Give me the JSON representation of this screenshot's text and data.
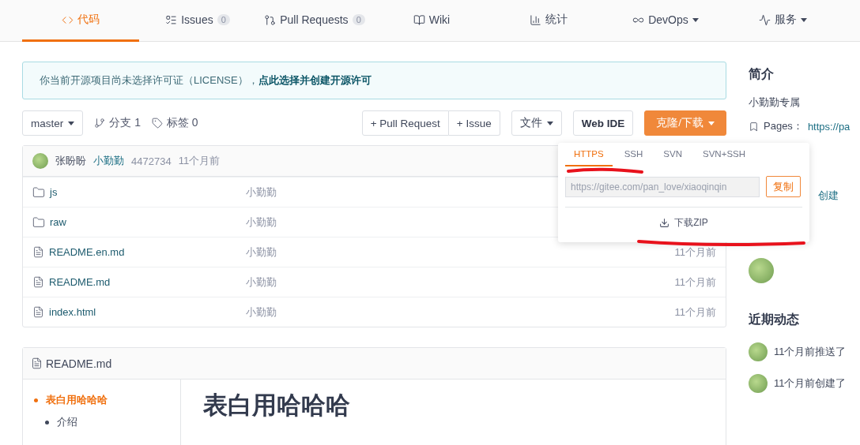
{
  "nav_tabs": [
    {
      "kind": "code",
      "label": "代码",
      "selected": true
    },
    {
      "kind": "issues",
      "label": "Issues",
      "count": "0",
      "selected": false
    },
    {
      "kind": "pr",
      "label": "Pull Requests",
      "count": "0",
      "selected": false
    },
    {
      "kind": "wiki",
      "label": "Wiki",
      "selected": false
    },
    {
      "kind": "stats",
      "label": "统计",
      "selected": false
    },
    {
      "kind": "devops",
      "label": "DevOps",
      "menu": true,
      "selected": false
    },
    {
      "kind": "service",
      "label": "服务",
      "menu": true,
      "selected": false
    }
  ],
  "license_notice": {
    "text": "你当前开源项目尚未选择许可证（LICENSE），",
    "link": "点此选择并创建开源许可"
  },
  "toolbar": {
    "branch": "master",
    "branches": "分支 1",
    "tags": "标签 0",
    "new_pr": "+ Pull Request",
    "new_issue": "+ Issue",
    "file_menu": "文件",
    "web_ide": "Web IDE",
    "clone": "克隆/下载"
  },
  "commit": {
    "author": "张盼盼",
    "message": "小勤勤",
    "hash": "4472734",
    "time": "11个月前"
  },
  "files": [
    {
      "kind": "folder",
      "name": "js",
      "commit": "小勤勤"
    },
    {
      "kind": "folder",
      "name": "raw",
      "commit": "小勤勤"
    },
    {
      "kind": "file",
      "name": "README.en.md",
      "commit": "小勤勤",
      "time": "11个月前"
    },
    {
      "kind": "file",
      "name": "README.md",
      "commit": "小勤勤",
      "time": "11个月前"
    },
    {
      "kind": "file",
      "name": "index.html",
      "commit": "小勤勤",
      "time": "11个月前"
    }
  ],
  "clone_popup": {
    "tabs": [
      {
        "label": "HTTPS",
        "selected": true
      },
      {
        "label": "SSH",
        "selected": false
      },
      {
        "label": "SVN",
        "selected": false
      },
      {
        "label": "SVN+SSH",
        "selected": false
      }
    ],
    "url": "https://gitee.com/pan_love/xiaoqinqin",
    "copy": "复制",
    "download": "下载ZIP"
  },
  "readme": {
    "title": "README.md",
    "toc": [
      {
        "label": "表白用哈哈哈",
        "selected": true,
        "children": [
          {
            "label": "介绍",
            "selected": false
          }
        ]
      }
    ],
    "heading": "表白用哈哈哈"
  },
  "sidebar": {
    "title": "简介",
    "description": "小勤勤专属",
    "pages_label": "Pages：",
    "pages_link": "https://pa",
    "create_link": "创建",
    "activity_title": "近期动态",
    "activities": [
      "11个月前推送了",
      "11个月前创建了"
    ]
  }
}
